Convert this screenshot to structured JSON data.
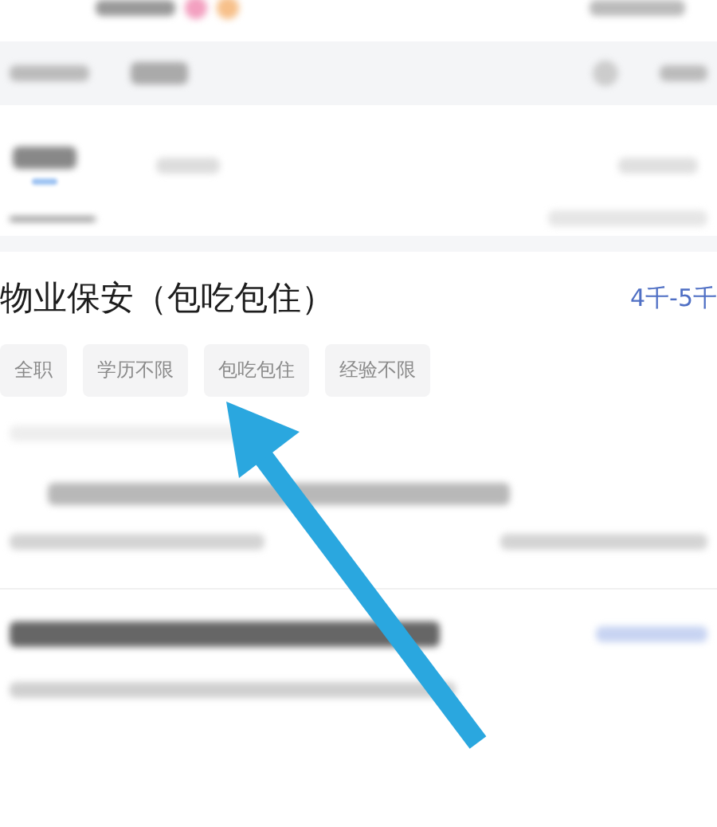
{
  "job": {
    "title": "物业保安（包吃包住）",
    "salary": "4千-5千",
    "tags": [
      {
        "label": "全职"
      },
      {
        "label": "学历不限"
      },
      {
        "label": "包吃包住"
      },
      {
        "label": "经验不限"
      }
    ]
  }
}
